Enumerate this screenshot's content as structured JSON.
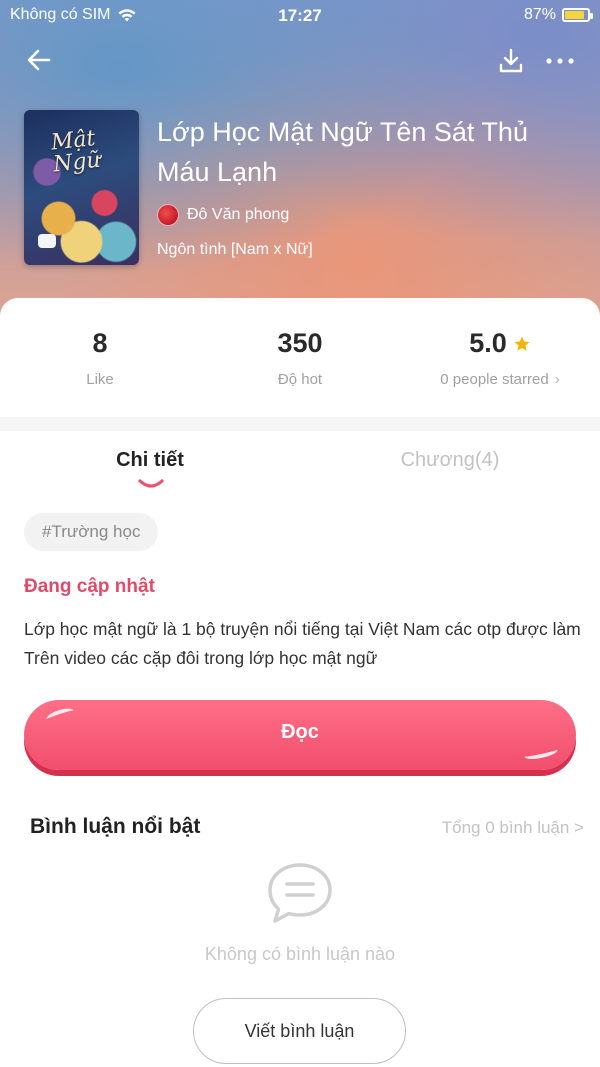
{
  "status_bar": {
    "carrier": "Không có SIM",
    "time": "17:27",
    "battery": "87%",
    "battery_level": 0.87
  },
  "nav": {
    "back_icon": "arrow-left-icon",
    "download_icon": "download-icon",
    "more_icon": "more-dots-icon"
  },
  "book": {
    "cover_title": "Mật Ngữ",
    "title": "Lớp Học Mật Ngữ Tên Sát Thủ Máu Lạnh",
    "author": "Đô Văn phong",
    "genre": "Ngôn tình [Nam x Nữ]"
  },
  "stats": {
    "likes_value": "8",
    "likes_label": "Like",
    "hot_value": "350",
    "hot_label": "Độ hot",
    "rating_value": "5.0",
    "rating_label": "0 people starred",
    "rating_chevron": "›"
  },
  "tabs": {
    "detail": "Chi tiết",
    "chapters": "Chương(4)"
  },
  "detail": {
    "tag": "#Trường học",
    "status": "Đang cập nhật",
    "description": "Lớp học mật ngữ là 1 bộ truyện nổi tiếng tại Việt Nam các otp được làm Trên video các cặp đôi trong lớp học mật ngữ",
    "read_button": "Đọc"
  },
  "comments": {
    "title": "Bình luận nổi bật",
    "total": "Tổng 0 bình luận >",
    "empty": "Không có bình luận nào",
    "write_button": "Viết bình luận"
  },
  "colors": {
    "accent": "#f04e6c",
    "status_pink": "#e04a6b",
    "star": "#f5b400"
  }
}
